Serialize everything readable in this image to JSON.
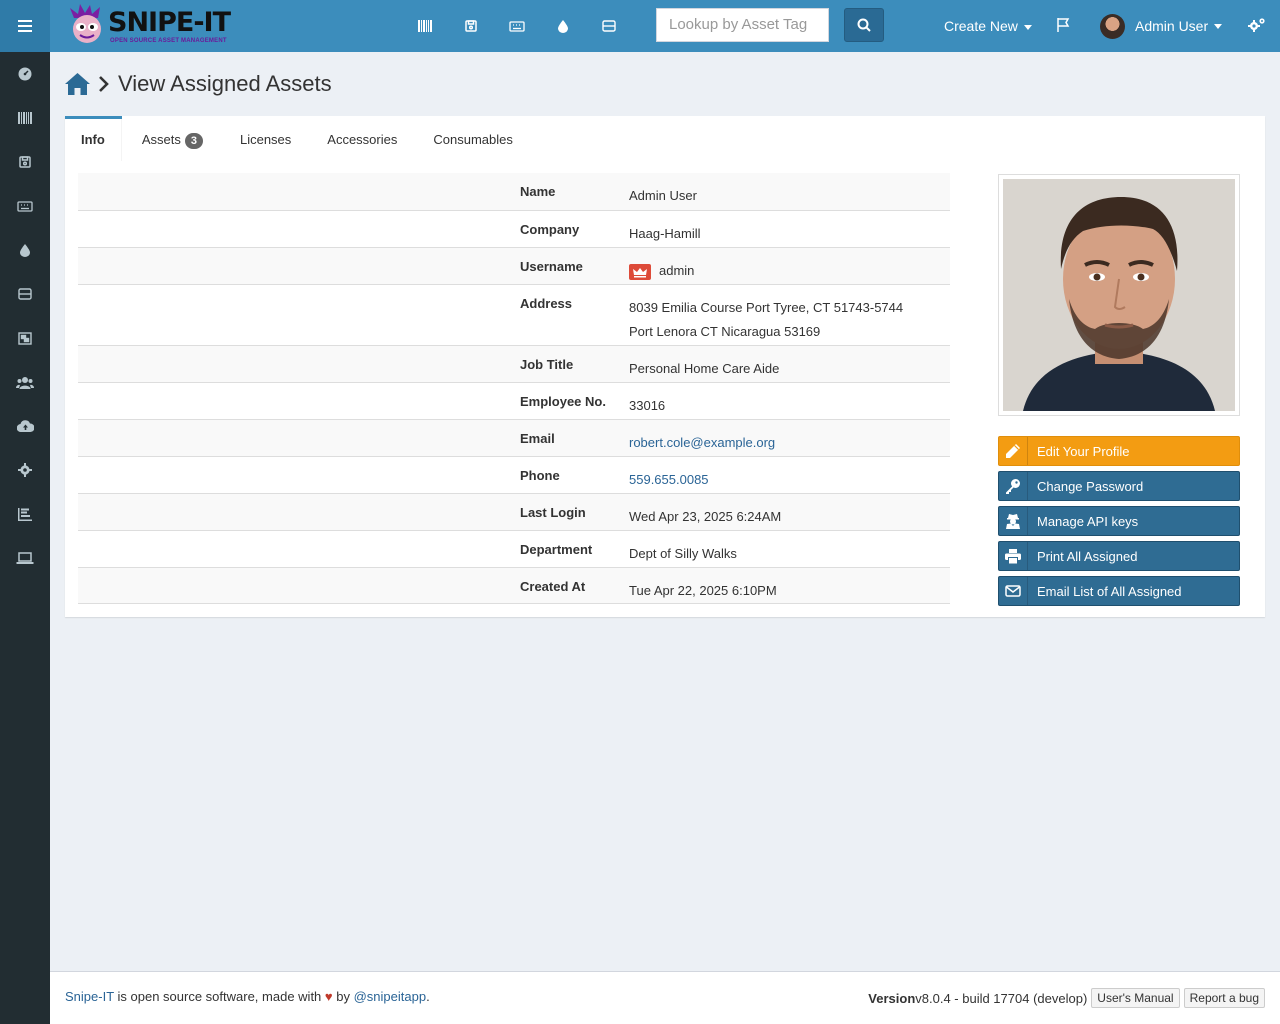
{
  "app": {
    "logo_text": "SNIPE-IT",
    "logo_tagline": "OPEN SOURCE ASSET MANAGEMENT"
  },
  "header": {
    "search_placeholder": "Lookup by Asset Tag",
    "create_new": "Create New",
    "user_name": "Admin User"
  },
  "page": {
    "title": "View Assigned Assets"
  },
  "tabs": [
    {
      "label": "Info"
    },
    {
      "label": "Assets",
      "badge": "3"
    },
    {
      "label": "Licenses"
    },
    {
      "label": "Accessories"
    },
    {
      "label": "Consumables"
    }
  ],
  "details": {
    "name": {
      "label": "Name",
      "value": "Admin User"
    },
    "company": {
      "label": "Company",
      "value": "Haag-Hamill"
    },
    "username": {
      "label": "Username",
      "value": "admin"
    },
    "address": {
      "label": "Address",
      "line1": "8039 Emilia Course Port Tyree, CT 51743-5744",
      "line2": "Port Lenora CT Nicaragua 53169"
    },
    "job_title": {
      "label": "Job Title",
      "value": "Personal Home Care Aide"
    },
    "employee_no": {
      "label": "Employee No.",
      "value": "33016"
    },
    "email": {
      "label": "Email",
      "value": "robert.cole@example.org"
    },
    "phone": {
      "label": "Phone",
      "value": "559.655.0085"
    },
    "last_login": {
      "label": "Last Login",
      "value": "Wed Apr 23, 2025 6:24AM"
    },
    "department": {
      "label": "Department",
      "value": "Dept of Silly Walks"
    },
    "created_at": {
      "label": "Created At",
      "value": "Tue Apr 22, 2025 6:10PM"
    }
  },
  "actions": {
    "edit_profile": "Edit Your Profile",
    "change_password": "Change Password",
    "manage_api": "Manage API keys",
    "print_all": "Print All Assigned",
    "email_list": "Email List of All Assigned"
  },
  "footer": {
    "brand": "Snipe-IT",
    "text1": " is open source software, made with ",
    "text2": " by ",
    "handle": "@snipeitapp",
    "period": ".",
    "version_label": "Version",
    "version_value": " v8.0.4 - build 17704 (develop)",
    "manual": "User's Manual",
    "report_bug": "Report a bug"
  },
  "colors": {
    "navbar": "#3c8dbc",
    "sidebar": "#222d32",
    "accent_orange": "#f39c12",
    "button_blue": "#2f6c93",
    "admin_badge": "#dd4b39"
  }
}
